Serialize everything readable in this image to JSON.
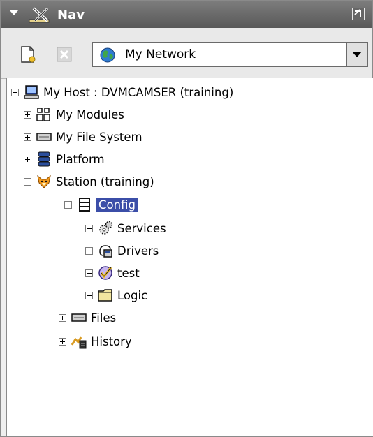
{
  "panel": {
    "title": "Nav",
    "icons": {
      "collapse": "collapse-arrow-icon",
      "app": "nav-x-icon",
      "maximize": "maximize-icon"
    }
  },
  "toolbar": {
    "new_button_icon": "new-document-icon",
    "delete_button_icon": "delete-icon",
    "network_select": {
      "selected": "My Network",
      "icon": "globe-icon"
    }
  },
  "tree": {
    "host": {
      "label": "My Host : DVMCAMSER (training)",
      "icon": "computer-icon",
      "expanded": true
    },
    "modules": {
      "label": "My Modules",
      "icon": "modules-icon",
      "expanded": false
    },
    "file_system": {
      "label": "My File System",
      "icon": "drive-icon",
      "expanded": false
    },
    "platform": {
      "label": "Platform",
      "icon": "platform-icon",
      "expanded": false
    },
    "station": {
      "label": "Station (training)",
      "icon": "fox-icon",
      "expanded": true
    },
    "config": {
      "label": "Config",
      "icon": "config-icon",
      "expanded": true,
      "selected": true
    },
    "services": {
      "label": "Services",
      "icon": "gears-icon",
      "expanded": false
    },
    "drivers": {
      "label": "Drivers",
      "icon": "drivers-icon",
      "expanded": false
    },
    "test": {
      "label": "test",
      "icon": "checkmark-icon",
      "expanded": false
    },
    "logic": {
      "label": "Logic",
      "icon": "folder-icon",
      "expanded": false
    },
    "files": {
      "label": "Files",
      "icon": "drive-icon",
      "expanded": false
    },
    "history": {
      "label": "History",
      "icon": "history-icon",
      "expanded": false
    }
  },
  "colors": {
    "selection": "#3b4ea8",
    "header": "#666666"
  }
}
